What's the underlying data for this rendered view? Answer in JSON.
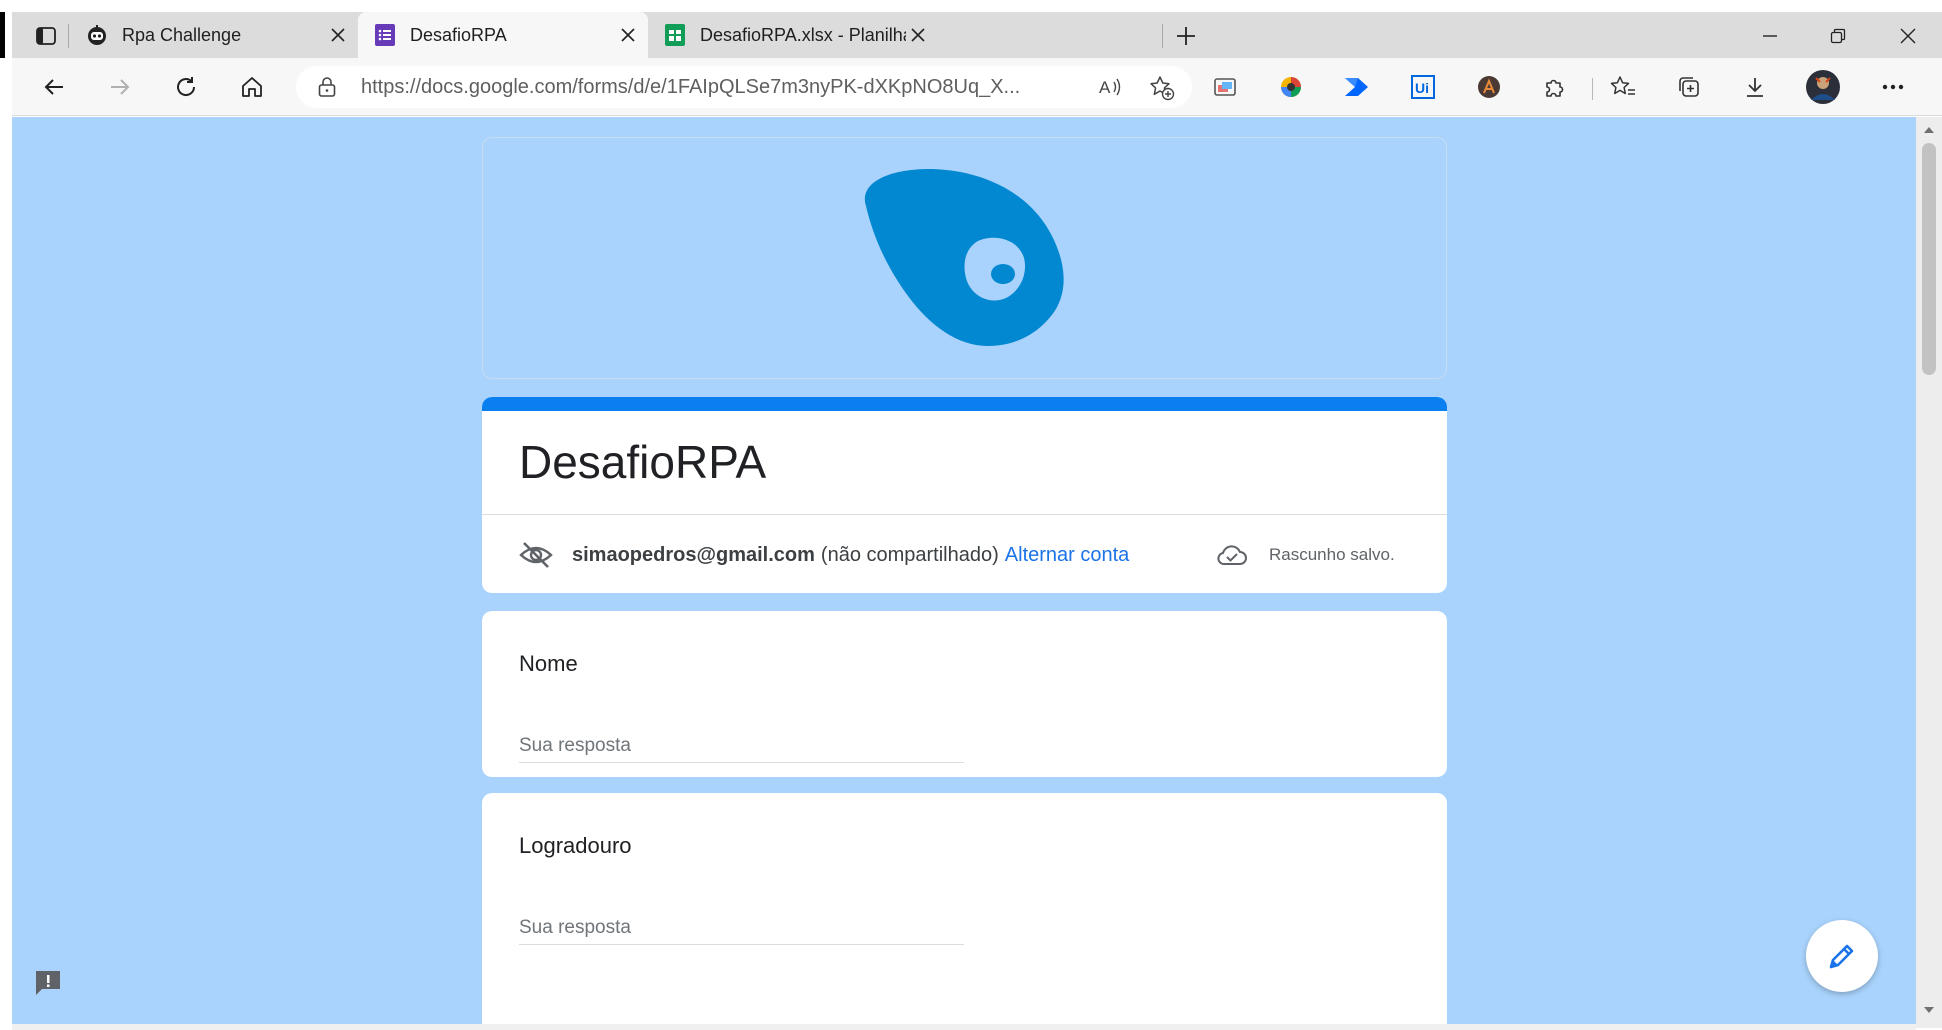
{
  "browser": {
    "tabs": [
      {
        "title": "Rpa Challenge",
        "icon": "robot-icon",
        "active": false
      },
      {
        "title": "DesafioRPA",
        "icon": "google-forms-icon",
        "active": true
      },
      {
        "title": "DesafioRPA.xlsx - Planilhas Goog",
        "icon": "google-sheets-icon",
        "active": false
      }
    ],
    "new_tab_label": "+",
    "url": "https://docs.google.com/forms/d/e/1FAIpQLSe7m3nyPK-dXKpNO8Uq_X..."
  },
  "form": {
    "title": "DesafioRPA",
    "account_email": "simaopedros@gmail.com",
    "not_shared_text": "(não compartilhado)",
    "switch_account_label": "Alternar conta",
    "draft_status": "Rascunho salvo.",
    "questions": [
      {
        "label": "Nome",
        "placeholder": "Sua resposta"
      },
      {
        "label": "Logradouro",
        "placeholder": "Sua resposta"
      }
    ]
  },
  "colors": {
    "page_background": "#a9d3fc",
    "accent": "#0a7fef",
    "logo": "#0288d1",
    "link": "#1a73e8"
  }
}
